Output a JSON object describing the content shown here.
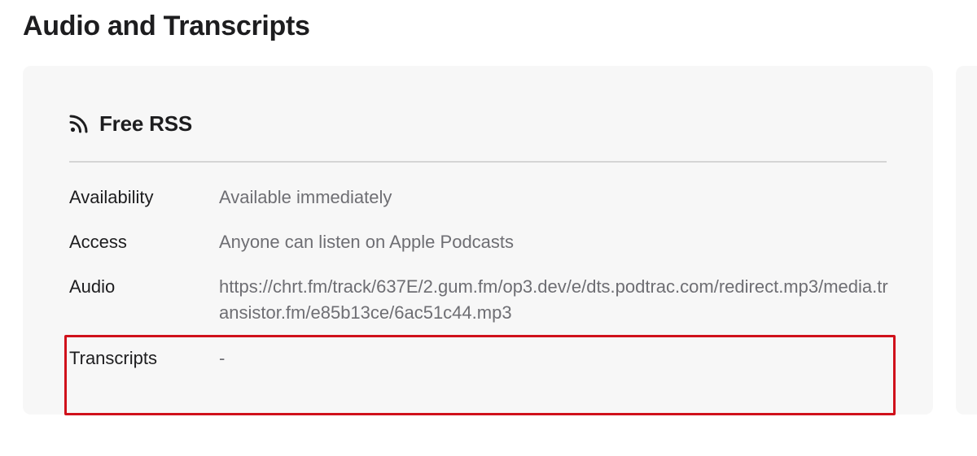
{
  "section": {
    "title": "Audio and Transcripts"
  },
  "card": {
    "icon": "rss-icon",
    "title": "Free RSS",
    "rows": [
      {
        "label": "Availability",
        "value": "Available immediately"
      },
      {
        "label": "Access",
        "value": "Anyone can listen on Apple Podcasts"
      },
      {
        "label": "Audio",
        "value": "https://chrt.fm/track/637E/2.gum.fm/op3.dev/e/dts.podtrac.com/redirect.mp3/media.transistor.fm/e85b13ce/6ac51c44.mp3"
      },
      {
        "label": "Transcripts",
        "value": "-"
      }
    ]
  },
  "colors": {
    "highlight": "#d0111b",
    "card_background": "#f7f7f7",
    "secondary_text": "#6e6e73"
  }
}
